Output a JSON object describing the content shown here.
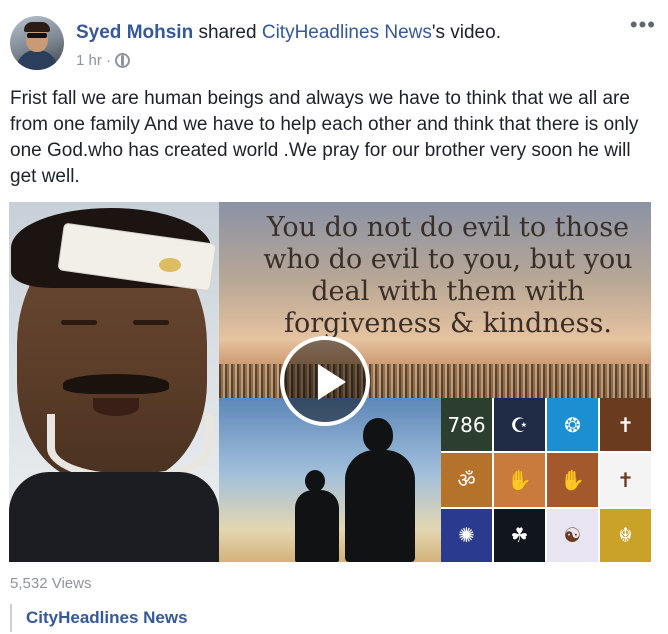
{
  "post": {
    "author": "Syed Mohsin",
    "action_text": " shared ",
    "shared_page": "CityHeadlines News",
    "shared_suffix": "'s video.",
    "time": "1 hr ·",
    "privacy_icon": "globe-icon",
    "more_icon": "•••",
    "text": "Frist fall we are human beings and always we have to think that we all are from one family And we have to help each other and think that there is only one God.who has created world .We pray for our brother very soon he will get well."
  },
  "video": {
    "quote_text": "You do not do evil to those who do evil to you, but you deal with them with forgiveness & kindness.",
    "play_icon": "play-icon",
    "collage_tiles": [
      {
        "glyph": "786",
        "bg": "#2c3e2e"
      },
      {
        "glyph": "☪",
        "bg": "#1f2a44"
      },
      {
        "glyph": "❂",
        "bg": "#1b8fd1"
      },
      {
        "glyph": "✝",
        "bg": "#6b3b1f"
      },
      {
        "glyph": "ॐ",
        "bg": "#b5722a"
      },
      {
        "glyph": "✋",
        "bg": "#c87b3c"
      },
      {
        "glyph": "✋",
        "bg": "#a4592c"
      },
      {
        "glyph": "✝",
        "bg": "#f4f4f4"
      },
      {
        "glyph": "✺",
        "bg": "#2a3b8f"
      },
      {
        "glyph": "☘",
        "bg": "#11161c"
      },
      {
        "glyph": "☯",
        "bg": "#e9e4f2"
      },
      {
        "glyph": "☬",
        "bg": "#c9a227"
      }
    ]
  },
  "stats": {
    "views": "5,532 Views"
  },
  "footer": {
    "page_name": "CityHeadlines News"
  }
}
